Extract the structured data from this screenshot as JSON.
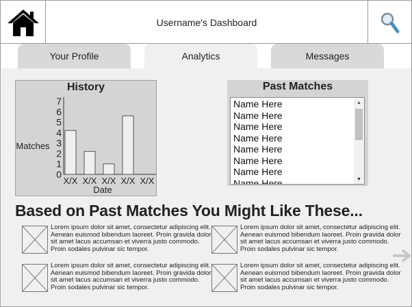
{
  "header": {
    "title": "Username's Dashboard",
    "home_icon": "home-icon",
    "search_icon": "magnifier-icon"
  },
  "tabs": [
    {
      "label": "Your Profile",
      "active": false
    },
    {
      "label": "Analytics",
      "active": true
    },
    {
      "label": "Messages",
      "active": false
    }
  ],
  "history": {
    "title": "History",
    "chart_data": {
      "type": "bar",
      "title": "History",
      "xlabel": "Date",
      "ylabel": "Matches",
      "ylim": [
        0,
        7
      ],
      "yticks": [
        "0",
        "1",
        "2",
        "3",
        "4",
        "5",
        "6",
        "7"
      ],
      "categories": [
        "X/X",
        "X/X",
        "X/X",
        "X/X",
        "X/X"
      ],
      "values": [
        4.2,
        2.2,
        1,
        5.6,
        0
      ],
      "bar_color": "#efefef"
    }
  },
  "past_matches": {
    "title": "Past Matches",
    "items": [
      "Name Here",
      "Name Here",
      "Name Here",
      "Name Here",
      "Name Here",
      "Name Here",
      "Name Here",
      "Name Here"
    ]
  },
  "recommendations": {
    "heading": "Based on Past Matches You Might Like These...",
    "cards": [
      {
        "text": "Lorem ipsum dolor sit amet, consectetur adipiscing elit. Aenean euismod bibendum laoreet. Proin gravida dolor sit amet lacus accumsan et viverra justo commodo. Proin sodales pulvinar sic tempor."
      },
      {
        "text": "Lorem ipsum dolor sit amet, consectetur adipiscing elit. Aenean euismod bibendum laoreet. Proin gravida dolor sit amet lacus accumsan et viverra justo commodo. Proin sodales pulvinar sic tempor."
      },
      {
        "text": "Lorem ipsum dolor sit amet, consectetur adipiscing elit. Aenean euismod bibendum laoreet. Proin gravida dolor sit amet lacus accumsan et viverra justo commodo. Proin sodales pulvinar sic tempor."
      },
      {
        "text": "Lorem ipsum dolor sit amet, consectetur adipiscing elit. Aenean euismod bibendum laoreet. Proin gravida dolor sit amet lacus accumsan et viverra justo commodo. Proin sodales pulvinar sic tempor."
      }
    ],
    "next_icon": "arrow-right-icon"
  }
}
